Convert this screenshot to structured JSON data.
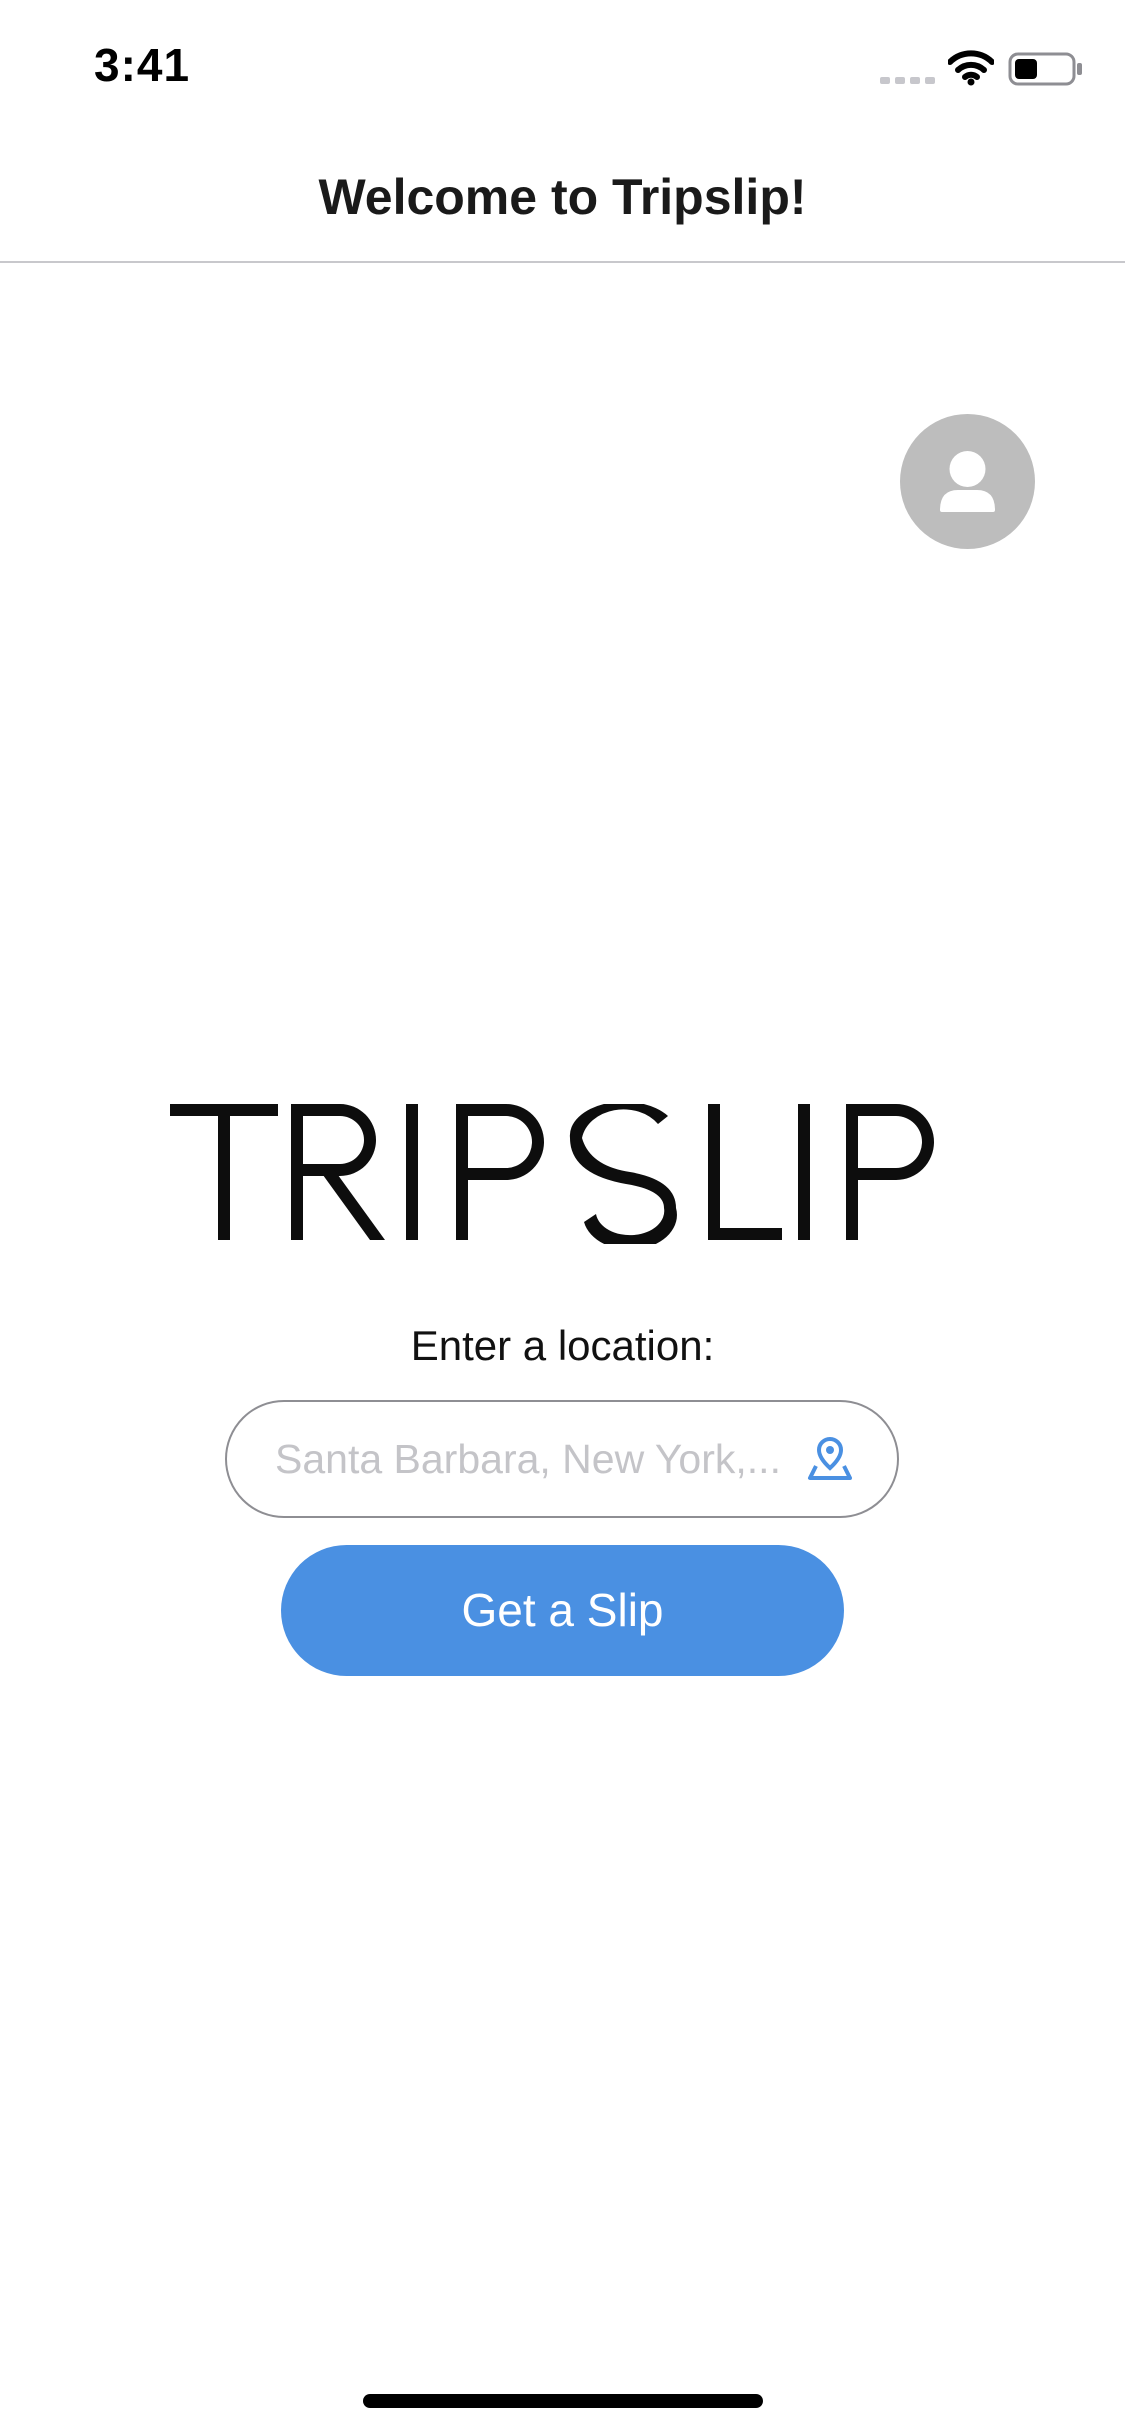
{
  "status_bar": {
    "time": "3:41",
    "icons": [
      "cellular-signal-icon",
      "wifi-icon",
      "battery-icon"
    ]
  },
  "header": {
    "title": "Welcome to Tripslip!"
  },
  "profile": {
    "icon": "user-icon",
    "color": "#bdbdbd"
  },
  "logo": {
    "text": "TRIPSLIP"
  },
  "location": {
    "label": "Enter a location:",
    "placeholder": "Santa Barbara, New York,...",
    "value": "",
    "icon": "map-pin-icon"
  },
  "action": {
    "button_label": "Get a Slip",
    "color": "#4a90e2"
  }
}
